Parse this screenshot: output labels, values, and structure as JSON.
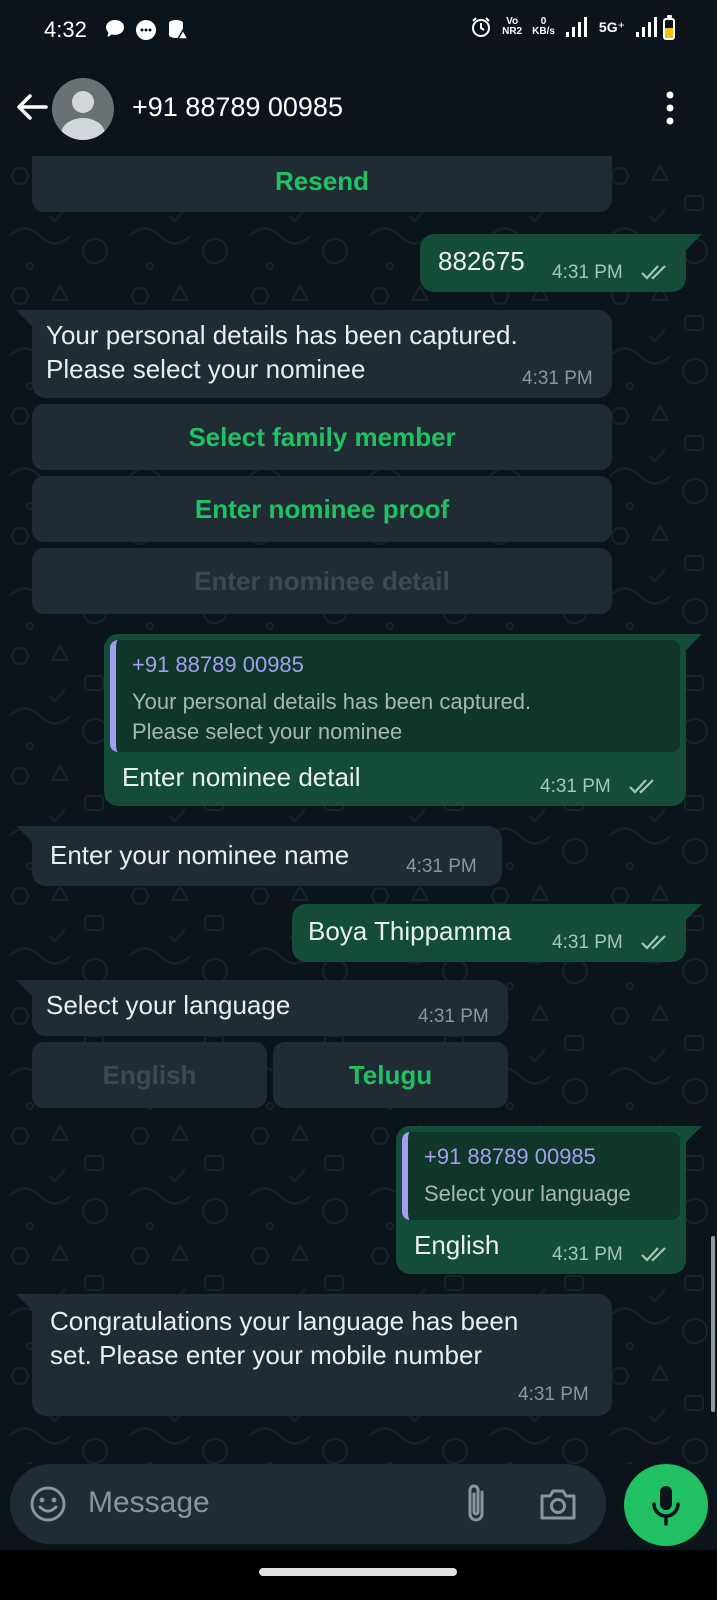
{
  "status_bar": {
    "time": "4:32",
    "volte": "Vo",
    "nr": "NR2",
    "speed_value": "0",
    "speed_unit": "KB/s",
    "network": "5G⁺"
  },
  "header": {
    "contact": "+91 88789 00985"
  },
  "messages": {
    "resend_button": "Resend",
    "otp": "882675",
    "otp_time": "4:31 PM",
    "captured_line1": "Your personal details has been captured.",
    "captured_line2": "Please select your nominee",
    "captured_time": "4:31 PM",
    "opt_family": "Select family member",
    "opt_proof": "Enter nominee proof",
    "opt_detail": "Enter nominee detail",
    "reply1_sender": "+91 88789 00985",
    "reply1_quote_line1": "Your personal details has been captured.",
    "reply1_quote_line2": "Please select your nominee",
    "reply1_text": "Enter nominee detail",
    "reply1_time": "4:31 PM",
    "ask_name": "Enter your nominee name",
    "ask_name_time": "4:31 PM",
    "name_reply": "Boya Thippamma",
    "name_reply_time": "4:31 PM",
    "ask_language": "Select your language",
    "ask_language_time": "4:31 PM",
    "lang_english": "English",
    "lang_telugu": "Telugu",
    "reply2_sender": "+91 88789 00985",
    "reply2_quote": "Select your language",
    "reply2_text": "English",
    "reply2_time": "4:31 PM",
    "congrats_line1": "Congratulations your language has been",
    "congrats_line2": "set. Please enter your mobile number",
    "congrats_time": "4:31 PM"
  },
  "composer": {
    "placeholder": "Message"
  },
  "colors": {
    "accent_green": "#21c063",
    "outgoing_bubble": "#144d37",
    "incoming_bubble": "#1f2c34",
    "quote_accent": "#a59df0",
    "background": "#0b141a"
  },
  "icons": [
    "back-arrow-icon",
    "avatar-icon",
    "more-vert-icon",
    "double-check-icon",
    "emoji-icon",
    "attach-icon",
    "camera-icon",
    "mic-icon"
  ]
}
